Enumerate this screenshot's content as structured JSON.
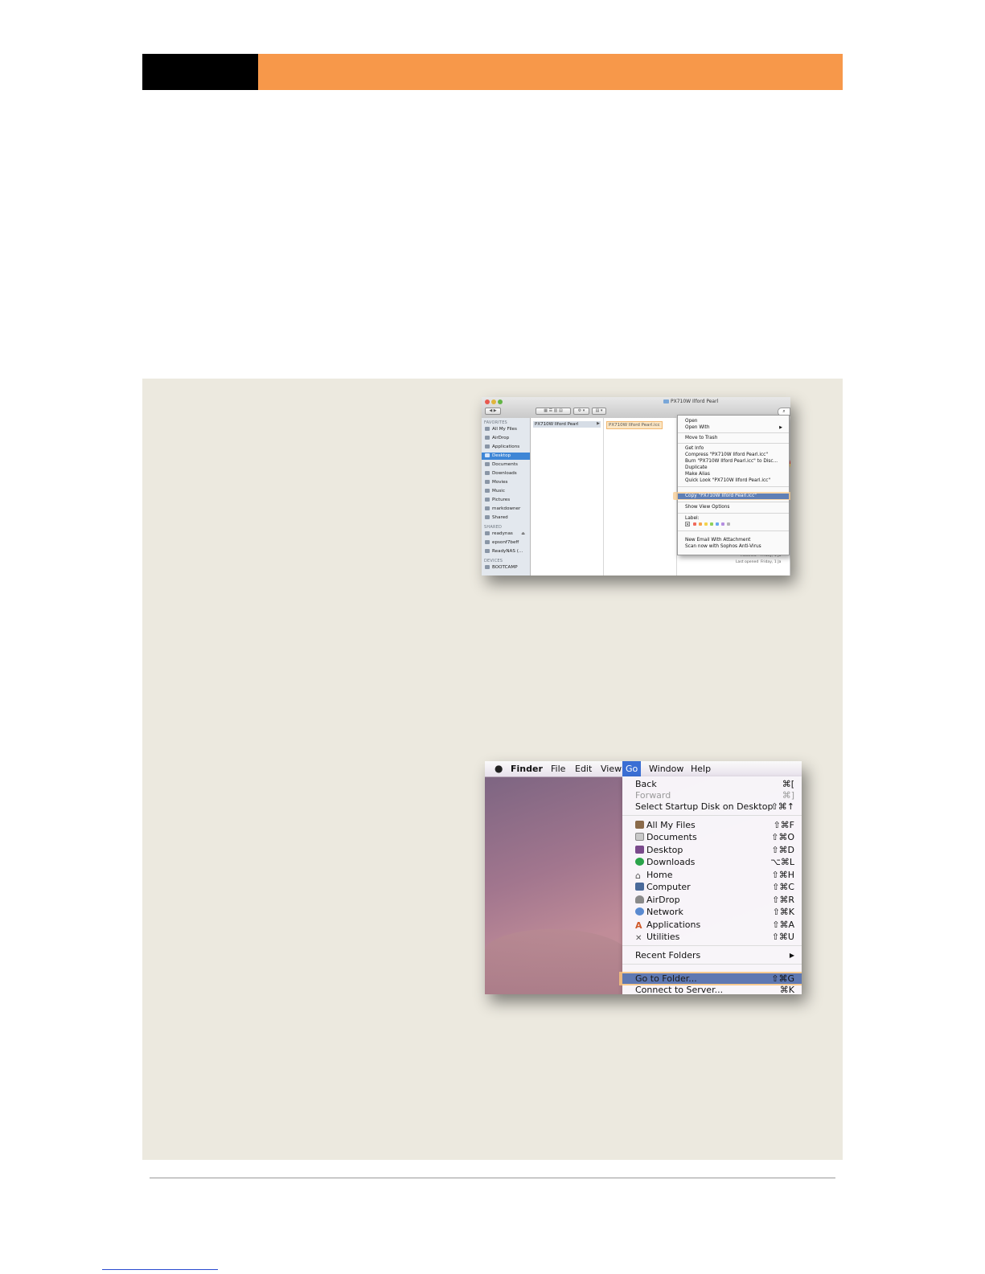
{
  "finder": {
    "title": "PX710W Ilford Pearl",
    "sidebar": {
      "favorites_header": "FAVORITES",
      "favorites": [
        "All My Files",
        "AirDrop",
        "Applications",
        "Desktop",
        "Documents",
        "Downloads",
        "Movies",
        "Music",
        "Pictures",
        "markdowner",
        "Shared"
      ],
      "selected": "Desktop",
      "shared_header": "SHARED",
      "shared": [
        "readynas",
        "epsonf7beff",
        "ReadyNAS (..."
      ],
      "devices_header": "DEVICES",
      "devices": [
        "BOOTCAMP"
      ]
    },
    "column1_item": "PX710W Ilford Pearl",
    "column2_item": "PX710W Ilford Pearl.icc",
    "context_menu": {
      "items": [
        "Open",
        "Open With",
        "Move to Trash",
        "Get Info",
        "Compress \"PX710W Ilford Pearl.icc\"",
        "Burn \"PX710W Ilford Pearl.icc\" to Disc...",
        "Duplicate",
        "Make Alias",
        "Quick Look \"PX710W Ilford Pearl.icc\"",
        "Copy \"PX710W Ilford Pearl.icc\"",
        "Show View Options",
        "Label:",
        "New Email With Attachment",
        "Scan now with Sophos Anti-Virus"
      ],
      "highlighted": "Copy \"PX710W Ilford Pearl.icc\"",
      "label_x": "✕",
      "label_colors": [
        "#f06a5c",
        "#f5a24b",
        "#f3d24a",
        "#8fd05a",
        "#6aa8f0",
        "#b58ee0",
        "#b5b5b5"
      ]
    },
    "preview": {
      "modified_label": "Modified",
      "modified_value": "Friday, 1 Ja",
      "opened_label": "Last opened",
      "opened_value": "Friday, 1 Ja"
    }
  },
  "go_menu": {
    "menubar": [
      "Finder",
      "File",
      "Edit",
      "View",
      "Go",
      "Window",
      "Help"
    ],
    "active": "Go",
    "items": [
      {
        "label": "Back",
        "shortcut": "⌘[",
        "icon": "",
        "disabled": false
      },
      {
        "label": "Forward",
        "shortcut": "⌘]",
        "icon": "",
        "disabled": true
      },
      {
        "label": "Select Startup Disk on Desktop",
        "shortcut": "⇧⌘↑",
        "icon": "",
        "disabled": false
      },
      {
        "label": "All My Files",
        "shortcut": "⇧⌘F",
        "icon": "all-my-files-icon",
        "color": "#8a6a4a"
      },
      {
        "label": "Documents",
        "shortcut": "⇧⌘O",
        "icon": "documents-icon",
        "color": "#c9c9c9"
      },
      {
        "label": "Desktop",
        "shortcut": "⇧⌘D",
        "icon": "desktop-icon",
        "color": "#7a4a8c"
      },
      {
        "label": "Downloads",
        "shortcut": "⌥⌘L",
        "icon": "downloads-icon",
        "color": "#2aa34a"
      },
      {
        "label": "Home",
        "shortcut": "⇧⌘H",
        "icon": "home-icon",
        "color": "#6c6c6c"
      },
      {
        "label": "Computer",
        "shortcut": "⇧⌘C",
        "icon": "computer-icon",
        "color": "#4a6a9a"
      },
      {
        "label": "AirDrop",
        "shortcut": "⇧⌘R",
        "icon": "airdrop-icon",
        "color": "#8a8a8a"
      },
      {
        "label": "Network",
        "shortcut": "⇧⌘K",
        "icon": "network-icon",
        "color": "#5a8ad0"
      },
      {
        "label": "Applications",
        "shortcut": "⇧⌘A",
        "icon": "applications-icon",
        "color": "#d05a2a"
      },
      {
        "label": "Utilities",
        "shortcut": "⇧⌘U",
        "icon": "utilities-icon",
        "color": "#707070"
      },
      {
        "label": "Recent Folders",
        "shortcut": "▶",
        "icon": "",
        "disabled": false
      },
      {
        "label": "Go to Folder...",
        "shortcut": "⇧⌘G",
        "icon": "",
        "disabled": false
      },
      {
        "label": "Connect to Server...",
        "shortcut": "⌘K",
        "icon": "",
        "disabled": false
      }
    ],
    "highlighted": "Go to Folder..."
  },
  "colors": {
    "header_black": "#000000",
    "header_orange": "#f7984a",
    "panel": "#ece9df",
    "highlight": "#f7c27e",
    "selection": "#3b6fd4"
  }
}
